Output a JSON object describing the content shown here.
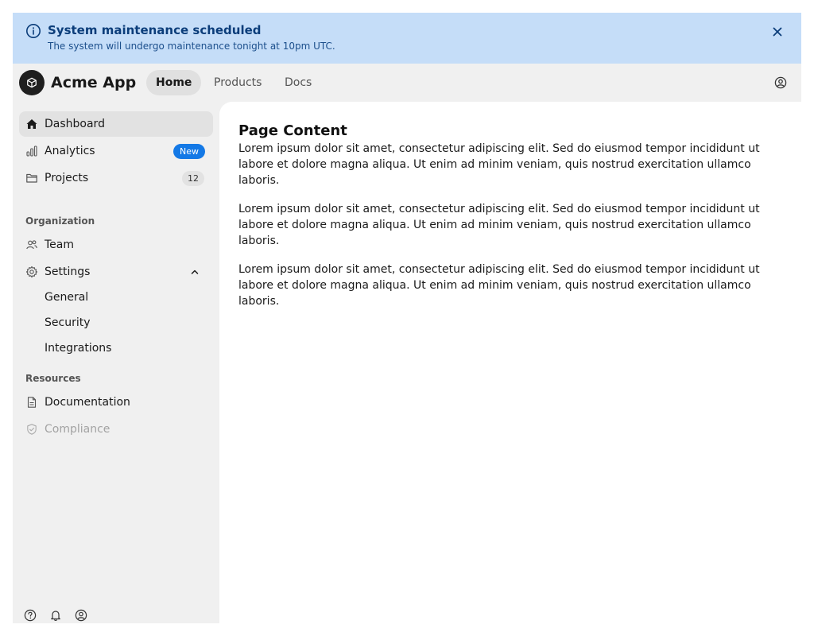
{
  "banner": {
    "title": "System maintenance scheduled",
    "message": "The system will undergo maintenance tonight at 10pm UTC.",
    "icon": "info-icon",
    "close_icon": "close-icon",
    "color": "#c5ddf8"
  },
  "header": {
    "app_name": "Acme App",
    "logo_icon": "cube-icon",
    "tabs": [
      {
        "label": "Home",
        "active": true
      },
      {
        "label": "Products",
        "active": false
      },
      {
        "label": "Docs",
        "active": false
      }
    ],
    "user_icon": "user-circle-icon"
  },
  "sidebar": {
    "items": [
      {
        "label": "Dashboard",
        "icon": "home-icon",
        "active": true
      },
      {
        "label": "Analytics",
        "icon": "bar-chart-icon",
        "badge": "New"
      },
      {
        "label": "Projects",
        "icon": "folder-icon",
        "badge": "12"
      }
    ],
    "sections": [
      {
        "label": "Organization",
        "items": [
          {
            "label": "Team",
            "icon": "users-icon"
          },
          {
            "label": "Settings",
            "icon": "gear-icon",
            "expanded": true,
            "children": [
              {
                "label": "General"
              },
              {
                "label": "Security"
              },
              {
                "label": "Integrations"
              }
            ]
          }
        ]
      },
      {
        "label": "Resources",
        "items": [
          {
            "label": "Documentation",
            "icon": "file-icon"
          },
          {
            "label": "Compliance",
            "icon": "shield-check-icon",
            "disabled": true
          }
        ]
      }
    ],
    "footer_icons": [
      "help-icon",
      "bell-icon",
      "user-circle-icon"
    ]
  },
  "main": {
    "title": "Page Content",
    "paragraphs": [
      "Lorem ipsum dolor sit amet, consectetur adipiscing elit. Sed do eiusmod tempor incididunt ut labore et dolore magna aliqua. Ut enim ad minim veniam, quis nostrud exercitation ullamco laboris.",
      "Lorem ipsum dolor sit amet, consectetur adipiscing elit. Sed do eiusmod tempor incididunt ut labore et dolore magna aliqua. Ut enim ad minim veniam, quis nostrud exercitation ullamco laboris.",
      "Lorem ipsum dolor sit amet, consectetur adipiscing elit. Sed do eiusmod tempor incididunt ut labore et dolore magna aliqua. Ut enim ad minim veniam, quis nostrud exercitation ullamco laboris."
    ]
  },
  "colors": {
    "accent": "#1479e6",
    "sidebar_bg": "#f0f0f0",
    "banner_text": "#0b3d7a"
  }
}
